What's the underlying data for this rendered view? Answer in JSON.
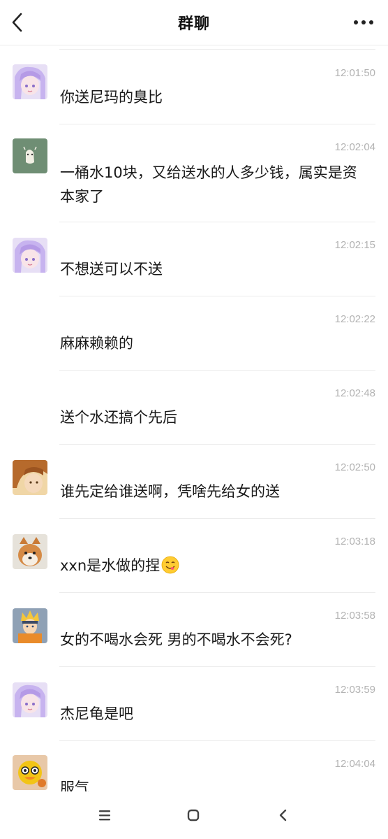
{
  "header": {
    "title": "群聊",
    "back_icon": "chevron-left-icon",
    "more_icon": "more-dots-icon"
  },
  "messages": [
    {
      "time": "12:01:50",
      "text": "你送尼玛的臭比",
      "avatar": "anime-girl-purple-avatar"
    },
    {
      "time": "12:02:04",
      "text": "一桶水10块，又给送水的人多少钱，属实是资本家了",
      "avatar": "green-cartoon-avatar"
    },
    {
      "time": "12:02:15",
      "text": "不想送可以不送",
      "avatar": "anime-girl-purple-avatar"
    },
    {
      "time": "12:02:22",
      "text": "麻麻赖赖的",
      "avatar": ""
    },
    {
      "time": "12:02:48",
      "text": "送个水还搞个先后",
      "avatar": ""
    },
    {
      "time": "12:02:50",
      "text": "谁先定给谁送啊，凭啥先给女的送",
      "avatar": "anime-boy-orange-avatar"
    },
    {
      "time": "12:03:18",
      "text": "xxn是水做的捏",
      "avatar": "shiba-dog-avatar",
      "emoji": "yum-emoji"
    },
    {
      "time": "12:03:58",
      "text": "女的不喝水会死 男的不喝水不会死?",
      "avatar": "anime-ninja-avatar"
    },
    {
      "time": "12:03:59",
      "text": "杰尼龟是吧",
      "avatar": "anime-girl-purple-avatar"
    },
    {
      "time": "12:04:04",
      "text": "服气",
      "avatar": "cartoon-duck-avatar"
    }
  ],
  "navbar": {
    "menu_icon": "menu-lines-icon",
    "home_icon": "home-square-icon",
    "back_icon": "nav-back-icon"
  },
  "colors": {
    "timestamp": "#b3b3b3",
    "divider": "#ececec",
    "text": "#1a1a1a"
  }
}
